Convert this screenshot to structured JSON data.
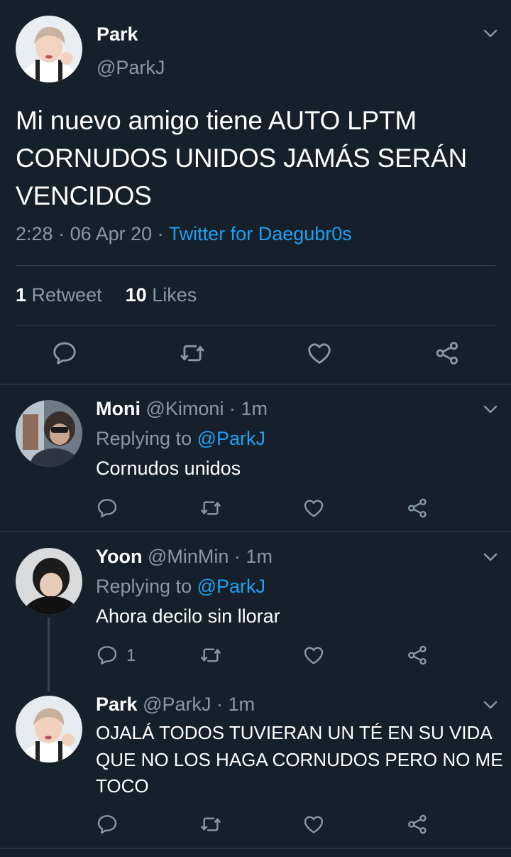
{
  "colors": {
    "background": "#15202b",
    "muted": "#8899a6",
    "link": "#1da1f2",
    "divider": "#38444d"
  },
  "main_tweet": {
    "name": "Park",
    "handle": "@ParkJ",
    "text": "Mi nuevo amigo tiene AUTO LPTM CORNUDOS UNIDOS JAMÁS SERÁN VENCIDOS",
    "time": "2:28",
    "date": "06 Apr 20",
    "source": "Twitter for Daegubr0s",
    "retweet_count": "1",
    "retweet_label": "Retweet",
    "likes_count": "10",
    "likes_label": "Likes",
    "icons": [
      "comment-icon",
      "retweet-icon",
      "like-icon",
      "share-icon"
    ]
  },
  "replies": [
    {
      "name": "Moni",
      "handle": "@Kimoni",
      "time": "1m",
      "replying_prefix": "Replying to",
      "replying_to": "@ParkJ",
      "text": "Cornudos unidos",
      "reply_count": ""
    },
    {
      "name": "Yoon",
      "handle": "@MinMin",
      "time": "1m",
      "replying_prefix": "Replying to",
      "replying_to": "@ParkJ",
      "text": "Ahora decilo sin llorar",
      "reply_count": "1"
    },
    {
      "name": "Park",
      "handle": "@ParkJ",
      "time": "1m",
      "text": "OJALÁ TODOS TUVIERAN UN TÉ EN SU VIDA QUE NO LOS HAGA CORNUDOS PERO NO ME TOCO",
      "reply_count": ""
    }
  ],
  "separator": " · "
}
